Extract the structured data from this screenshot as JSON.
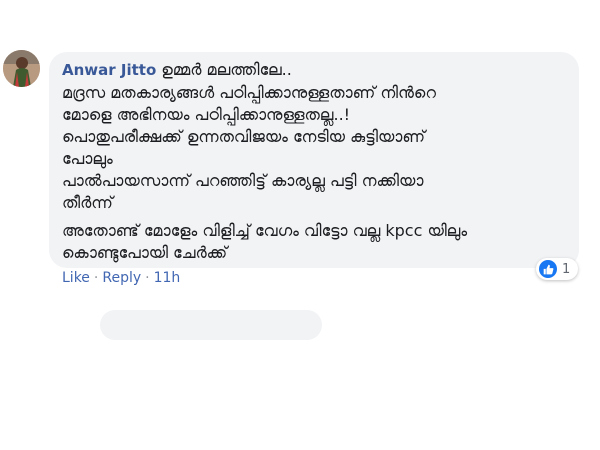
{
  "comment": {
    "author": "Anwar Jitto",
    "lines": [
      "ഉമ്മർ മലത്തിലേ..",
      "മദ്രസ മതകാര്യങ്ങൾ പഠിപ്പിക്കാനുള്ളതാണ് നിൻറെ",
      "മോളെ അഭിനയം പഠിപ്പിക്കാനുള്ളതല്ല..!",
      "പൊതുപരീക്ഷക്ക് ഉന്നതവിജയം നേടിയ കുട്ടിയാണ്",
      "പോലും",
      "പാൽപായസാന്ന് പറഞ്ഞിട്ട് കാര്യല്ല പട്ടി നക്കിയാ",
      "തീർന്ന്",
      "അതോണ്ട് മോളേം വിളിച്ച് വേഗം വിട്ടോ വല്ല kpcc യിലും",
      "കൊണ്ടുപോയി ചേർക്ക്"
    ],
    "actions": {
      "like": "Like",
      "reply": "Reply",
      "time": "11h"
    },
    "reactions": {
      "icon": "like-icon",
      "count": "1",
      "color": "#1877f2"
    }
  }
}
